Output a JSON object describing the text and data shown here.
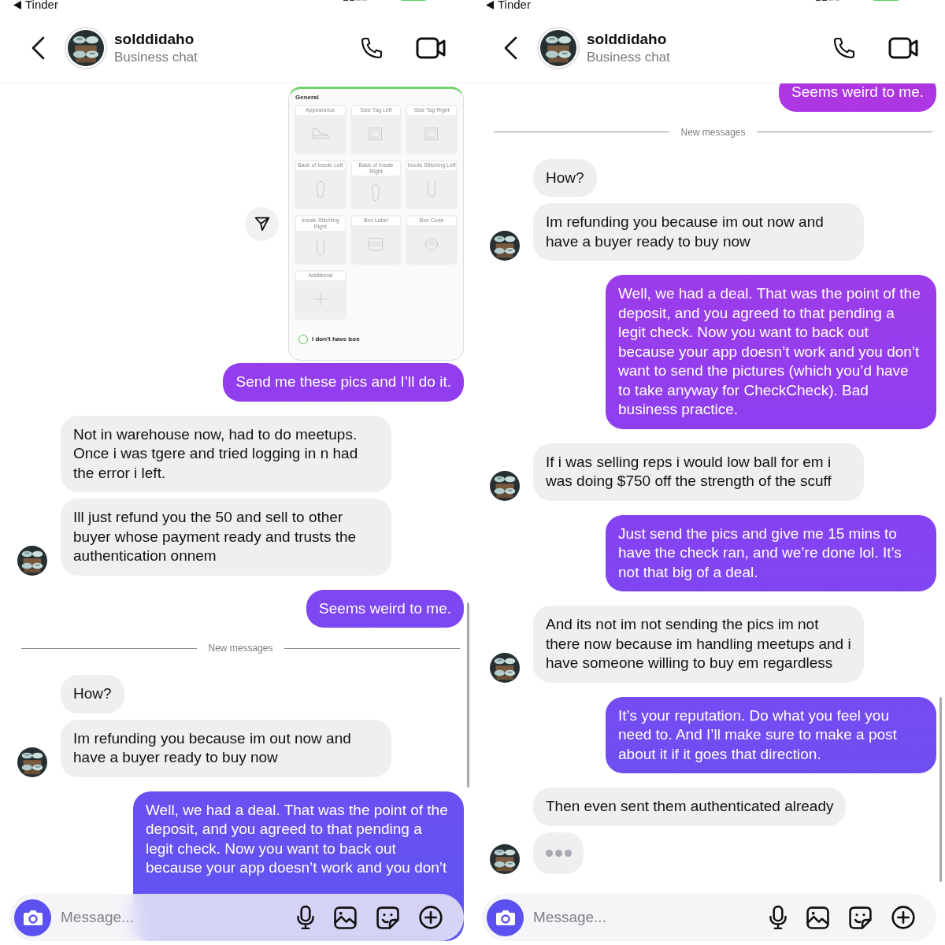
{
  "panels": [
    {
      "status_bar": {
        "back_app": "Tinder"
      },
      "contact": {
        "name": "solddidaho",
        "subtitle": "Business chat"
      },
      "messages": [
        {
          "kind": "screenshot",
          "section": "General",
          "tiles": [
            {
              "label": "Appearance",
              "kind": "sneaker"
            },
            {
              "label": "Size Tag Left",
              "kind": "tag"
            },
            {
              "label": "Size Tag Right",
              "kind": "tag"
            },
            {
              "label": "Back of Insole Left",
              "kind": "insole"
            },
            {
              "label": "Back of Insole Right",
              "kind": "insole"
            },
            {
              "label": "Insole Stitching Left",
              "kind": "stitching"
            },
            {
              "label": "Insole Stitching Right",
              "kind": "stitching"
            },
            {
              "label": "Box Label",
              "kind": "box-label"
            },
            {
              "label": "Box Code",
              "kind": "box-code"
            },
            {
              "label": "Additional",
              "kind": "add"
            }
          ],
          "option": {
            "label": "I don't have box",
            "checked": false
          }
        },
        {
          "kind": "outgoing",
          "text": "Send me these pics and I’ll do it."
        },
        {
          "kind": "incoming",
          "text": "Not in warehouse now, had to do meetups. Once i was tgere and tried logging in n had the error i left.",
          "show_avatar": false
        },
        {
          "kind": "incoming",
          "text": "Ill just refund you the 50 and sell to other buyer whose payment ready and trusts the authentication onnem",
          "show_avatar": true
        },
        {
          "kind": "outgoing",
          "text": "Seems weird to me."
        },
        {
          "kind": "divider",
          "text": "New messages"
        },
        {
          "kind": "incoming",
          "text": "How?",
          "show_avatar": false
        },
        {
          "kind": "incoming",
          "text": "Im refunding you because im out now and have a buyer ready to buy now",
          "show_avatar": true
        },
        {
          "kind": "outgoing",
          "text": "Well, we had a deal. That was the point of the deposit, and you agreed to that pending a legit check. Now you want to back out because your app doesn’t work and you don’t"
        }
      ],
      "composer": {
        "placeholder": "Message..."
      }
    },
    {
      "status_bar": {
        "back_app": "Tinder"
      },
      "contact": {
        "name": "solddidaho",
        "subtitle": "Business chat"
      },
      "messages": [
        {
          "kind": "outgoing",
          "text": "Seems weird to me."
        },
        {
          "kind": "divider",
          "text": "New messages"
        },
        {
          "kind": "incoming",
          "text": "How?",
          "show_avatar": false
        },
        {
          "kind": "incoming",
          "text": "Im refunding you because im out now and have a buyer ready to buy now",
          "show_avatar": true
        },
        {
          "kind": "outgoing",
          "text": "Well, we had a deal. That was the point of the deposit, and you agreed to that pending a legit check. Now you want to back out because your app doesn’t work and you don’t want to send the pictures (which you’d have to take anyway for CheckCheck). Bad business practice."
        },
        {
          "kind": "incoming",
          "text": "If i was selling reps i would low ball for em i was doing $750 off the strength of the scuff",
          "show_avatar": true
        },
        {
          "kind": "outgoing",
          "text": "Just send the pics and give me 15 mins to have the check ran, and we’re done lol. It’s not that big of a deal."
        },
        {
          "kind": "incoming",
          "text": "And its not im not sending the pics im not there now because im handling meetups and i have someone willing to buy em regardless",
          "show_avatar": true
        },
        {
          "kind": "outgoing",
          "text": "It’s your reputation. Do what you feel you need to. And I’ll make sure to make a post about it if it goes that direction."
        },
        {
          "kind": "incoming",
          "text": "Then even sent them authenticated already",
          "show_avatar": false
        },
        {
          "kind": "typing",
          "show_avatar": true
        }
      ],
      "composer": {
        "placeholder": "Message..."
      }
    }
  ]
}
